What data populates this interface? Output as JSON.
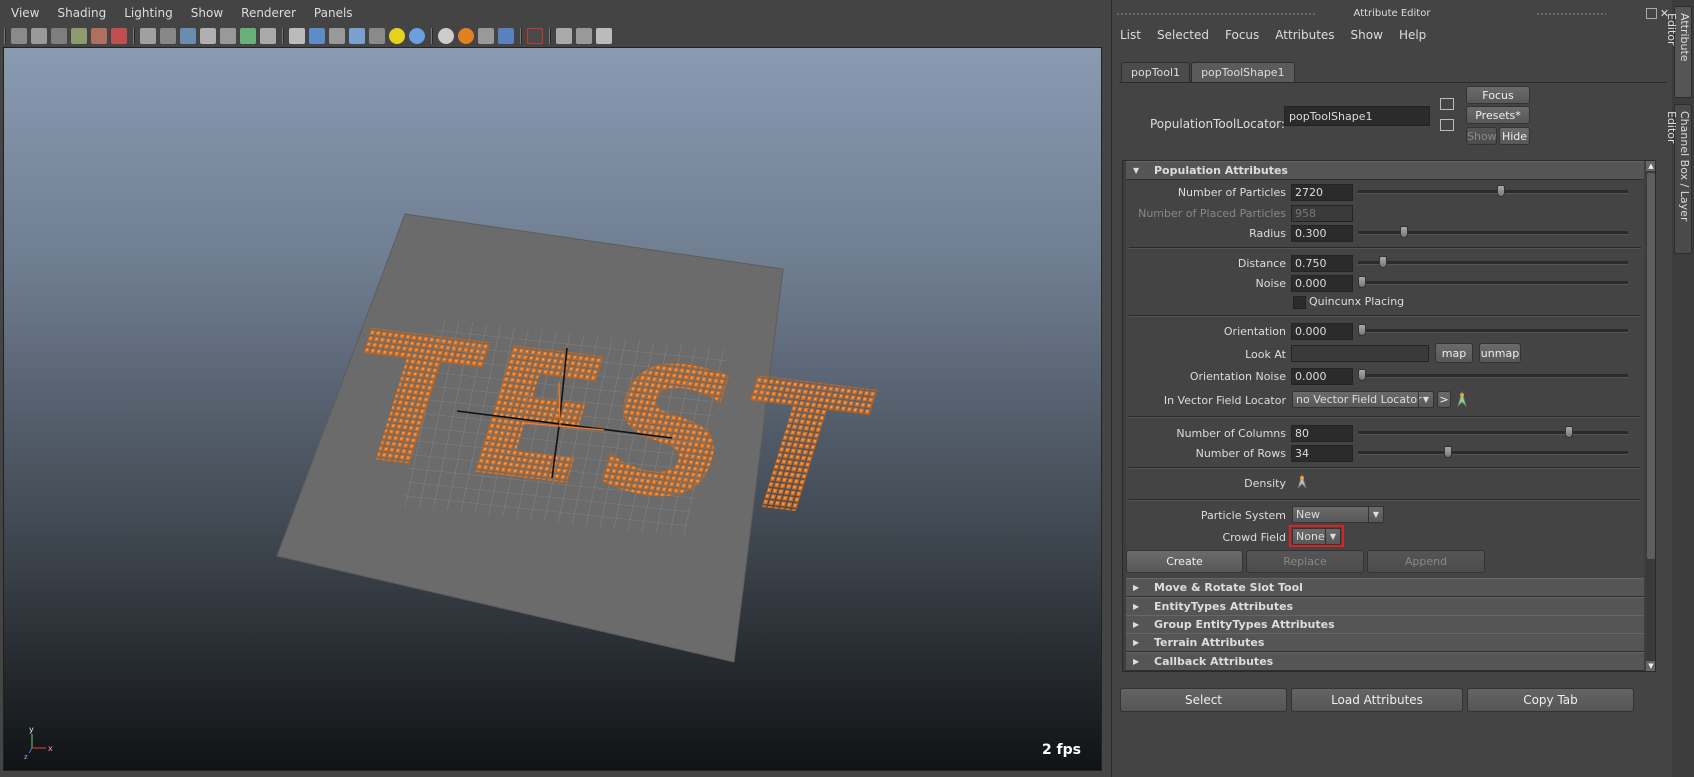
{
  "viewport_menu": [
    "View",
    "Shading",
    "Lighting",
    "Show",
    "Renderer",
    "Panels"
  ],
  "viewport": {
    "fps": "2 fps",
    "scene_text": "TEST",
    "axis_x": "x",
    "axis_y": "y",
    "axis_z": "z"
  },
  "attribute_editor": {
    "title": "Attribute Editor",
    "menu": [
      "List",
      "Selected",
      "Focus",
      "Attributes",
      "Show",
      "Help"
    ],
    "tabs": [
      "popTool1",
      "popToolShape1"
    ],
    "active_tab": "popToolShape1",
    "locator_label": "PopulationToolLocator:",
    "locator_value": "popToolShape1",
    "buttons": {
      "focus": "Focus",
      "presets": "Presets*",
      "show": "Show",
      "hide": "Hide"
    },
    "population": {
      "header": "Population Attributes",
      "number_of_particles": {
        "label": "Number of Particles",
        "value": "2720",
        "level": 0.53
      },
      "placed_particles": {
        "label": "Number of Placed Particles",
        "value": "958"
      },
      "radius": {
        "label": "Radius",
        "value": "0.300",
        "level": 0.16
      },
      "distance": {
        "label": "Distance",
        "value": "0.750",
        "level": 0.08
      },
      "noise": {
        "label": "Noise",
        "value": "0.000",
        "level": 0.0
      },
      "quincunx": {
        "label": "Quincunx Placing",
        "checked": false
      },
      "orientation": {
        "label": "Orientation",
        "value": "0.000",
        "level": 0.0
      },
      "look_at": {
        "label": "Look At",
        "value": "",
        "map": "map",
        "unmap": "unmap"
      },
      "orientation_noise": {
        "label": "Orientation Noise",
        "value": "0.000",
        "level": 0.0
      },
      "vector_field": {
        "label": "In Vector Field Locator",
        "value": "no Vector Field Locator",
        "go": ">"
      },
      "columns": {
        "label": "Number of Columns",
        "value": "80",
        "level": 0.79
      },
      "rows": {
        "label": "Number of Rows",
        "value": "34",
        "level": 0.33
      },
      "density": {
        "label": "Density"
      },
      "particle_system": {
        "label": "Particle System",
        "value": "New"
      },
      "crowd_field": {
        "label": "Crowd Field",
        "value": "None"
      },
      "create": "Create",
      "replace": "Replace",
      "append": "Append"
    },
    "sections": [
      "Move & Rotate Slot Tool",
      "EntityTypes Attributes",
      "Group EntityTypes Attributes",
      "Terrain Attributes",
      "Callback Attributes"
    ],
    "bottom_buttons": [
      "Select",
      "Load Attributes",
      "Copy Tab"
    ]
  },
  "side_tabs": [
    "Attribute Editor",
    "Channel Box / Layer Editor"
  ],
  "colors": {
    "highlight": "#dd2222",
    "particles": "#e07a20"
  }
}
